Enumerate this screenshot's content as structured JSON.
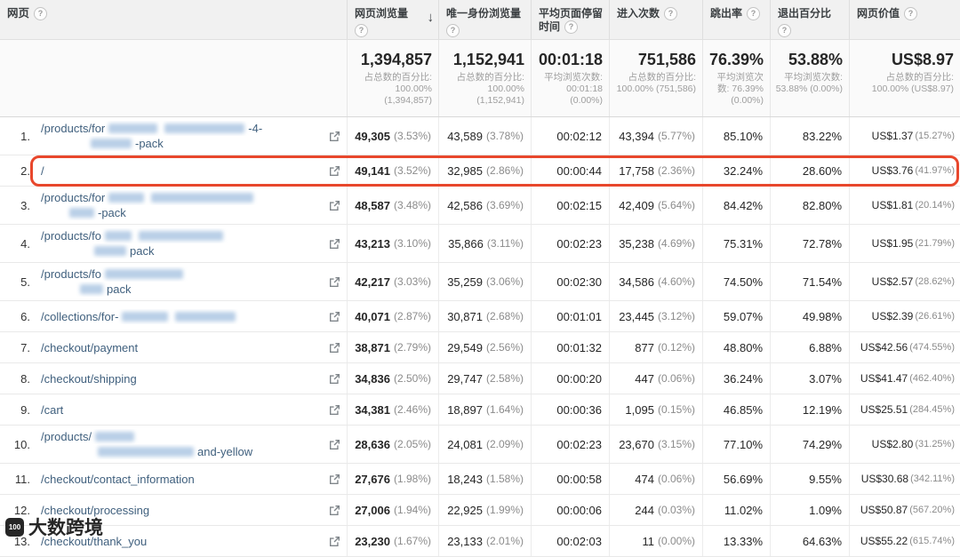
{
  "icons": {
    "help": "?",
    "sort_desc": "↓"
  },
  "columns": [
    {
      "key": "page",
      "label": "网页"
    },
    {
      "key": "pageviews",
      "label": "网页浏览量",
      "sort": "↓"
    },
    {
      "key": "unique-pageviews",
      "label": "唯一身份浏览量"
    },
    {
      "key": "avg-time-on-page",
      "label": "平均页面停留时间"
    },
    {
      "key": "entrances",
      "label": "进入次数"
    },
    {
      "key": "bounce-rate",
      "label": "跳出率"
    },
    {
      "key": "exit-percent",
      "label": "退出百分比"
    },
    {
      "key": "page-value",
      "label": "网页价值"
    }
  ],
  "summary": [
    {
      "big": "1,394,857",
      "sub": "占总数的百分比: 100.00% (1,394,857)"
    },
    {
      "big": "1,152,941",
      "sub": "占总数的百分比: 100.00% (1,152,941)"
    },
    {
      "big": "00:01:18",
      "sub": "平均浏览次数: 00:01:18 (0.00%)"
    },
    {
      "big": "751,586",
      "sub": "占总数的百分比: 100.00% (751,586)"
    },
    {
      "big": "76.39%",
      "sub": "平均浏览次数: 76.39% (0.00%)"
    },
    {
      "big": "53.88%",
      "sub": "平均浏览次数: 53.88% (0.00%)"
    },
    {
      "big": "US$8.97",
      "sub": "占总数的百分比: 100.00% (US$8.97)"
    }
  ],
  "watermark": {
    "logo": "100",
    "text": "大数跨境"
  },
  "rows": [
    {
      "n": "1.",
      "page": [
        {
          "indent": 0,
          "segs": [
            [
              "t",
              "/products/for"
            ],
            [
              "b",
              55
            ],
            [
              "b",
              90
            ],
            [
              "t",
              "-4-"
            ]
          ]
        },
        {
          "indent": 52,
          "segs": [
            [
              "b",
              46
            ],
            [
              "t",
              "-pack"
            ]
          ]
        }
      ],
      "pv": "49,305",
      "pvp": "(3.53%)",
      "upv": "43,589",
      "upvp": "(3.78%)",
      "time": "00:02:12",
      "ent": "43,394",
      "entp": "(5.77%)",
      "bounce": "85.10%",
      "exit": "83.22%",
      "val": "US$1.37",
      "valp": "(15.27%)"
    },
    {
      "n": "2.",
      "highlight": true,
      "page": [
        {
          "indent": 0,
          "segs": [
            [
              "t",
              "/"
            ]
          ]
        }
      ],
      "pv": "49,141",
      "pvp": "(3.52%)",
      "upv": "32,985",
      "upvp": "(2.86%)",
      "time": "00:00:44",
      "ent": "17,758",
      "entp": "(2.36%)",
      "bounce": "32.24%",
      "exit": "28.60%",
      "val": "US$3.76",
      "valp": "(41.97%)"
    },
    {
      "n": "3.",
      "page": [
        {
          "indent": 0,
          "segs": [
            [
              "t",
              "/products/for"
            ],
            [
              "b",
              40
            ],
            [
              "b",
              115
            ]
          ]
        },
        {
          "indent": 28,
          "segs": [
            [
              "b",
              28
            ],
            [
              "t",
              "-pack"
            ]
          ]
        }
      ],
      "pv": "48,587",
      "pvp": "(3.48%)",
      "upv": "42,586",
      "upvp": "(3.69%)",
      "time": "00:02:15",
      "ent": "42,409",
      "entp": "(5.64%)",
      "bounce": "84.42%",
      "exit": "82.80%",
      "val": "US$1.81",
      "valp": "(20.14%)"
    },
    {
      "n": "4.",
      "page": [
        {
          "indent": 0,
          "segs": [
            [
              "t",
              "/products/fo"
            ],
            [
              "b",
              30
            ],
            [
              "b",
              95
            ]
          ]
        },
        {
          "indent": 56,
          "segs": [
            [
              "b",
              36
            ],
            [
              "t",
              "pack"
            ]
          ]
        }
      ],
      "pv": "43,213",
      "pvp": "(3.10%)",
      "upv": "35,866",
      "upvp": "(3.11%)",
      "time": "00:02:23",
      "ent": "35,238",
      "entp": "(4.69%)",
      "bounce": "75.31%",
      "exit": "72.78%",
      "val": "US$1.95",
      "valp": "(21.79%)"
    },
    {
      "n": "5.",
      "page": [
        {
          "indent": 0,
          "segs": [
            [
              "t",
              "/products/fo"
            ],
            [
              "b",
              88
            ]
          ]
        },
        {
          "indent": 40,
          "segs": [
            [
              "b",
              26
            ],
            [
              "t",
              "pack"
            ]
          ]
        }
      ],
      "pv": "42,217",
      "pvp": "(3.03%)",
      "upv": "35,259",
      "upvp": "(3.06%)",
      "time": "00:02:30",
      "ent": "34,586",
      "entp": "(4.60%)",
      "bounce": "74.50%",
      "exit": "71.54%",
      "val": "US$2.57",
      "valp": "(28.62%)"
    },
    {
      "n": "6.",
      "page": [
        {
          "indent": 0,
          "segs": [
            [
              "t",
              "/collections/for-"
            ],
            [
              "b",
              52
            ],
            [
              "b",
              68
            ]
          ]
        }
      ],
      "pv": "40,071",
      "pvp": "(2.87%)",
      "upv": "30,871",
      "upvp": "(2.68%)",
      "time": "00:01:01",
      "ent": "23,445",
      "entp": "(3.12%)",
      "bounce": "59.07%",
      "exit": "49.98%",
      "val": "US$2.39",
      "valp": "(26.61%)"
    },
    {
      "n": "7.",
      "page": [
        {
          "indent": 0,
          "segs": [
            [
              "t",
              "/checkout/payment"
            ]
          ]
        }
      ],
      "pv": "38,871",
      "pvp": "(2.79%)",
      "upv": "29,549",
      "upvp": "(2.56%)",
      "time": "00:01:32",
      "ent": "877",
      "entp": "(0.12%)",
      "bounce": "48.80%",
      "exit": "6.88%",
      "val": "US$42.56",
      "valp": "(474.55%)"
    },
    {
      "n": "8.",
      "page": [
        {
          "indent": 0,
          "segs": [
            [
              "t",
              "/checkout/shipping"
            ]
          ]
        }
      ],
      "pv": "34,836",
      "pvp": "(2.50%)",
      "upv": "29,747",
      "upvp": "(2.58%)",
      "time": "00:00:20",
      "ent": "447",
      "entp": "(0.06%)",
      "bounce": "36.24%",
      "exit": "3.07%",
      "val": "US$41.47",
      "valp": "(462.40%)"
    },
    {
      "n": "9.",
      "page": [
        {
          "indent": 0,
          "segs": [
            [
              "t",
              "/cart"
            ]
          ]
        }
      ],
      "pv": "34,381",
      "pvp": "(2.46%)",
      "upv": "18,897",
      "upvp": "(1.64%)",
      "time": "00:00:36",
      "ent": "1,095",
      "entp": "(0.15%)",
      "bounce": "46.85%",
      "exit": "12.19%",
      "val": "US$25.51",
      "valp": "(284.45%)"
    },
    {
      "n": "10.",
      "page": [
        {
          "indent": 0,
          "segs": [
            [
              "t",
              "/products/"
            ],
            [
              "b",
              44
            ]
          ]
        },
        {
          "indent": 60,
          "segs": [
            [
              "b",
              108
            ],
            [
              "t",
              "and-yellow"
            ]
          ]
        }
      ],
      "pv": "28,636",
      "pvp": "(2.05%)",
      "upv": "24,081",
      "upvp": "(2.09%)",
      "time": "00:02:23",
      "ent": "23,670",
      "entp": "(3.15%)",
      "bounce": "77.10%",
      "exit": "74.29%",
      "val": "US$2.80",
      "valp": "(31.25%)"
    },
    {
      "n": "11.",
      "page": [
        {
          "indent": 0,
          "segs": [
            [
              "t",
              "/checkout/contact_information"
            ]
          ]
        }
      ],
      "pv": "27,676",
      "pvp": "(1.98%)",
      "upv": "18,243",
      "upvp": "(1.58%)",
      "time": "00:00:58",
      "ent": "474",
      "entp": "(0.06%)",
      "bounce": "56.69%",
      "exit": "9.55%",
      "val": "US$30.68",
      "valp": "(342.11%)"
    },
    {
      "n": "12.",
      "page": [
        {
          "indent": 0,
          "segs": [
            [
              "t",
              "/checkout/processing"
            ]
          ]
        }
      ],
      "pv": "27,006",
      "pvp": "(1.94%)",
      "upv": "22,925",
      "upvp": "(1.99%)",
      "time": "00:00:06",
      "ent": "244",
      "entp": "(0.03%)",
      "bounce": "11.02%",
      "exit": "1.09%",
      "val": "US$50.87",
      "valp": "(567.20%)"
    },
    {
      "n": "13.",
      "page": [
        {
          "indent": 0,
          "segs": [
            [
              "t",
              "/checkout/thank_you"
            ]
          ]
        }
      ],
      "pv": "23,230",
      "pvp": "(1.67%)",
      "upv": "23,133",
      "upvp": "(2.01%)",
      "time": "00:02:03",
      "ent": "11",
      "entp": "(0.00%)",
      "bounce": "13.33%",
      "exit": "64.63%",
      "val": "US$55.22",
      "valp": "(615.74%)"
    }
  ]
}
